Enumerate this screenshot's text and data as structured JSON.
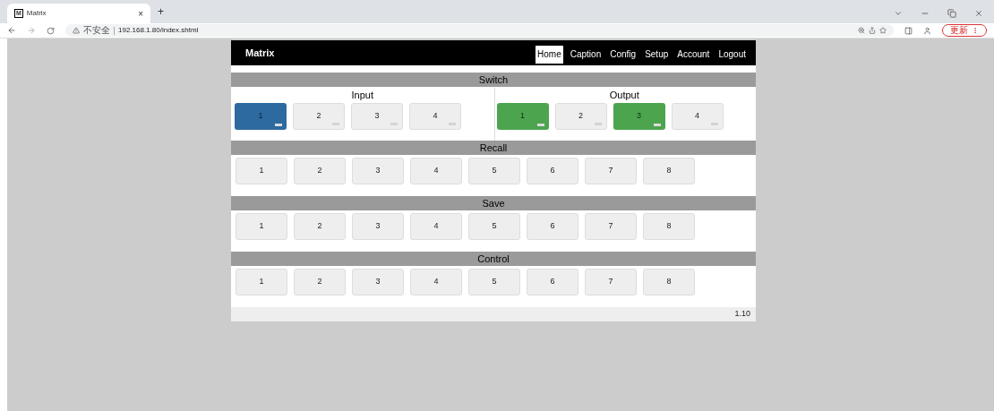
{
  "browser": {
    "tab": {
      "favicon": "M",
      "title": "Matrix",
      "close": "×"
    },
    "new_tab": "+",
    "security": "不安全",
    "url": "192.168.1.80/index.shtml",
    "update_button": "更新"
  },
  "header": {
    "title": "Matrix",
    "nav": [
      {
        "label": "Home",
        "selected": true
      },
      {
        "label": "Caption",
        "selected": false
      },
      {
        "label": "Config",
        "selected": false
      },
      {
        "label": "Setup",
        "selected": false
      },
      {
        "label": "Account",
        "selected": false
      },
      {
        "label": "Logout",
        "selected": false
      }
    ]
  },
  "switch": {
    "title": "Switch",
    "groups": [
      {
        "kind": "input",
        "label": "Input",
        "buttons": [
          {
            "label": "1",
            "selected": true
          },
          {
            "label": "2",
            "selected": false
          },
          {
            "label": "3",
            "selected": false
          },
          {
            "label": "4",
            "selected": false
          }
        ]
      },
      {
        "kind": "output",
        "label": "Output",
        "buttons": [
          {
            "label": "1",
            "selected": true
          },
          {
            "label": "2",
            "selected": false
          },
          {
            "label": "3",
            "selected": true
          },
          {
            "label": "4",
            "selected": false
          }
        ]
      }
    ]
  },
  "sections": [
    {
      "title": "Recall",
      "buttons": [
        "1",
        "2",
        "3",
        "4",
        "5",
        "6",
        "7",
        "8"
      ]
    },
    {
      "title": "Save",
      "buttons": [
        "1",
        "2",
        "3",
        "4",
        "5",
        "6",
        "7",
        "8"
      ]
    },
    {
      "title": "Control",
      "buttons": [
        "1",
        "2",
        "3",
        "4",
        "5",
        "6",
        "7",
        "8"
      ]
    }
  ],
  "footer": {
    "version": "1.10"
  }
}
